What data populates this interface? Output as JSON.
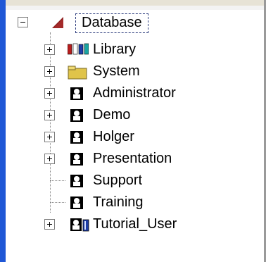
{
  "tree": {
    "root": {
      "label": "Database",
      "expander": "minus",
      "icon": "database-icon"
    },
    "items": [
      {
        "label": "Library",
        "icon": "library-icon",
        "expander": "plus"
      },
      {
        "label": "System",
        "icon": "folder-icon",
        "expander": "plus"
      },
      {
        "label": "Administrator",
        "icon": "user-icon",
        "expander": "plus"
      },
      {
        "label": "Demo",
        "icon": "user-icon",
        "expander": "plus"
      },
      {
        "label": "Holger",
        "icon": "user-icon",
        "expander": "plus"
      },
      {
        "label": "Presentation",
        "icon": "user-icon",
        "expander": "plus"
      },
      {
        "label": "Support",
        "icon": "user-icon",
        "expander": "none"
      },
      {
        "label": "Training",
        "icon": "user-icon",
        "expander": "none"
      },
      {
        "label": "Tutorial_User",
        "icon": "user-book-icon",
        "expander": "plus"
      }
    ]
  },
  "colors": {
    "accent_blue": "#1f57d6",
    "db_red": "#8b1e1e",
    "folder_yellow": "#e0c44a",
    "library_red": "#b81d1d"
  }
}
